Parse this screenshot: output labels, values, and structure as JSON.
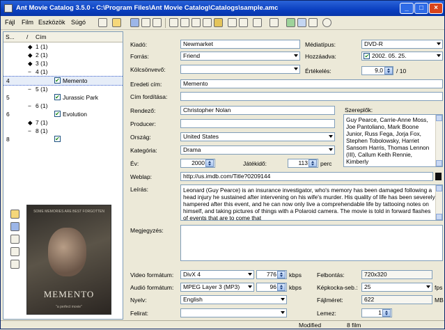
{
  "window": {
    "title": "Ant Movie Catalog 3.5.0 - C:\\Program Files\\Ant Movie Catalog\\Catalogs\\sample.amc",
    "minimize": "_",
    "maximize": "□",
    "close": "×"
  },
  "menu": [
    "Fájl",
    "Film",
    "Eszközök",
    "Súgó"
  ],
  "list": {
    "col_num": "S...",
    "col_title": "Cím",
    "sort_arrow": "/",
    "rows": [
      {
        "num": "",
        "label": "1 (1)",
        "marker": "◆"
      },
      {
        "num": "",
        "label": "2 (1)",
        "marker": "◆"
      },
      {
        "num": "",
        "label": "3 (1)",
        "marker": "◆"
      },
      {
        "num": "",
        "label": "4 (1)",
        "marker": "−"
      },
      {
        "num": "4",
        "label": "Memento",
        "checked": "✔",
        "selected": true
      },
      {
        "num": "",
        "label": "5 (1)",
        "marker": "−"
      },
      {
        "num": "5",
        "label": "Jurassic Park",
        "checked": "✔"
      },
      {
        "num": "",
        "label": "6 (1)",
        "marker": "−"
      },
      {
        "num": "6",
        "label": "Evolution",
        "checked": "✔"
      },
      {
        "num": "",
        "label": "7 (1)",
        "marker": "◆"
      },
      {
        "num": "",
        "label": "8 (1)",
        "marker": "−"
      },
      {
        "num": "8",
        "label": "",
        "checked": "✔"
      }
    ]
  },
  "poster": {
    "title": "MEMENTO",
    "tagline": "SOME MEMORIES ARE BEST FORGOTTEN",
    "bottom": "\"a perfect movie\""
  },
  "form": {
    "kiado_label": "Kiadó:",
    "kiado": "Newmarket",
    "forras_label": "Forrás:",
    "forras": "Friend",
    "kolcson_label": "Kölcsönvevő:",
    "kolcson": "",
    "eredeti_label": "Eredeti cím:",
    "eredeti": "Memento",
    "forditas_label": "Cím fordítása:",
    "forditas": "",
    "rendezo_label": "Rendező:",
    "rendezo": "Christopher Nolan",
    "producer_label": "Producer:",
    "producer": "",
    "orszag_label": "Ország:",
    "orszag": "United States",
    "kategoria_label": "Kategória:",
    "kategoria": "Drama",
    "ev_label": "Év:",
    "ev": "2000",
    "jatekido_label": "Játékidő:",
    "jatekido": "113",
    "perc": "perc",
    "mediatipus_label": "Médiatípus:",
    "mediatipus": "DVD-R",
    "hozzaadva_label": "Hozzáadva:",
    "hozzaadva": "2002. 05. 25.",
    "ertekeles_label": "Értékelés:",
    "ertekeles": "9,0",
    "ertekeles_max": "/ 10",
    "szereplok_label": "Szereplők:",
    "szereplok": "Guy Pearce, Carrie-Anne Moss, Joe Pantoliano, Mark Boone Junior, Russ Fega, Jorja Fox, Stephen Tobolowsky, Harriet Sansom Harris, Thomas Lennon (III), Callum Keith Rennie, Kimberly",
    "weblap_label": "Weblap:",
    "weblap": "http://us.imdb.com/Title?0209144",
    "leiras_label": "Leírás:",
    "leiras": "Leonard (Guy Pearce) is an insurance investigator, who's memory has been damaged following a head injury he sustained after intervening on his wife's murder. His quality of life has been severely hampered after this event, and he can now only live a comprehendable life by tattooing notes on himself, and taking pictures of things with a Polaroid camera. The movie is told in forward flashes of events that are to come that",
    "megjegyzes_label": "Megjegyzés:",
    "megjegyzes": "",
    "video_label": "Video formátum:",
    "video": "DivX 4",
    "video_kbps": "776",
    "kbps": "kbps",
    "audio_label": "Audió formátum:",
    "audio": "MPEG Layer 3 (MP3)",
    "audio_kbps": "96",
    "nyelv_label": "Nyelv:",
    "nyelv": "English",
    "felirat_label": "Felirat:",
    "felirat": "",
    "felbontas_label": "Felbontás:",
    "felbontas": "720x320",
    "kepkocka_label": "Képkocka-seb.:",
    "kepkocka": "25",
    "fps": "fps",
    "fajlmeret_label": "Fájlméret:",
    "fajlmeret": "622",
    "mb": "MB",
    "lemez_label": "Lemez:",
    "lemez": "1"
  },
  "status": {
    "state": "Modified",
    "count": "8 film"
  }
}
